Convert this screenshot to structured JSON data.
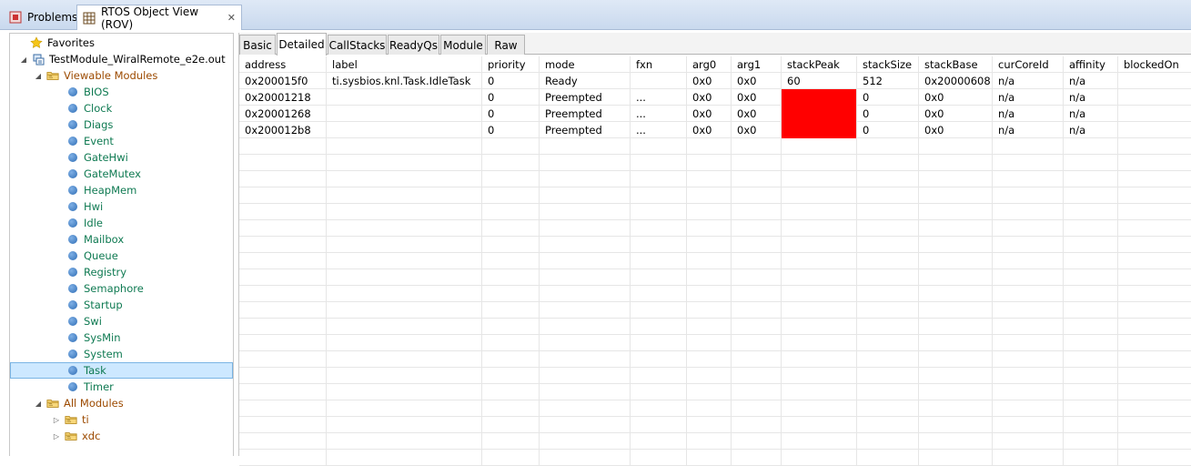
{
  "view_tabs": {
    "problems": "Problems",
    "rov": "RTOS Object View (ROV)",
    "close": "✕"
  },
  "tree": {
    "favorites": "Favorites",
    "target": "TestModule_WiralRemote_e2e.out",
    "viewable_modules": "Viewable Modules",
    "modules": [
      "BIOS",
      "Clock",
      "Diags",
      "Event",
      "GateHwi",
      "GateMutex",
      "HeapMem",
      "Hwi",
      "Idle",
      "Mailbox",
      "Queue",
      "Registry",
      "Semaphore",
      "Startup",
      "Swi",
      "SysMin",
      "System",
      "Task",
      "Timer"
    ],
    "selected_module": "Task",
    "all_modules": "All Modules",
    "packages": [
      "ti",
      "xdc"
    ]
  },
  "subtabs": [
    "Basic",
    "Detailed",
    "CallStacks",
    "ReadyQs",
    "Module",
    "Raw"
  ],
  "active_subtab": "Detailed",
  "table": {
    "columns": [
      "address",
      "label",
      "priority",
      "mode",
      "fxn",
      "arg0",
      "arg1",
      "stackPeak",
      "stackSize",
      "stackBase",
      "curCoreId",
      "affinity",
      "blockedOn"
    ],
    "rows": [
      [
        "0x200015f0",
        "ti.sysbios.knl.Task.IdleTask",
        "0",
        "Ready",
        "",
        "0x0",
        "0x0",
        "60",
        "512",
        "0x20000608",
        "n/a",
        "n/a",
        ""
      ],
      [
        "0x20001218",
        "",
        "0",
        "Preempted",
        "...",
        "0x0",
        "0x0",
        "",
        "0",
        "0x0",
        "n/a",
        "n/a",
        ""
      ],
      [
        "0x20001268",
        "",
        "0",
        "Preempted",
        "...",
        "0x0",
        "0x0",
        "",
        "0",
        "0x0",
        "n/a",
        "n/a",
        ""
      ],
      [
        "0x200012b8",
        "",
        "0",
        "Preempted",
        "...",
        "0x0",
        "0x0",
        "",
        "0",
        "0x0",
        "n/a",
        "n/a",
        ""
      ]
    ],
    "error_cells": [
      [
        1,
        7
      ],
      [
        2,
        7
      ],
      [
        3,
        7
      ]
    ],
    "error_color": "#ff0000"
  },
  "colors": {
    "module_text": "#0f7a52",
    "folder_text": "#9c4a00",
    "selection_bg": "#cde8ff"
  }
}
